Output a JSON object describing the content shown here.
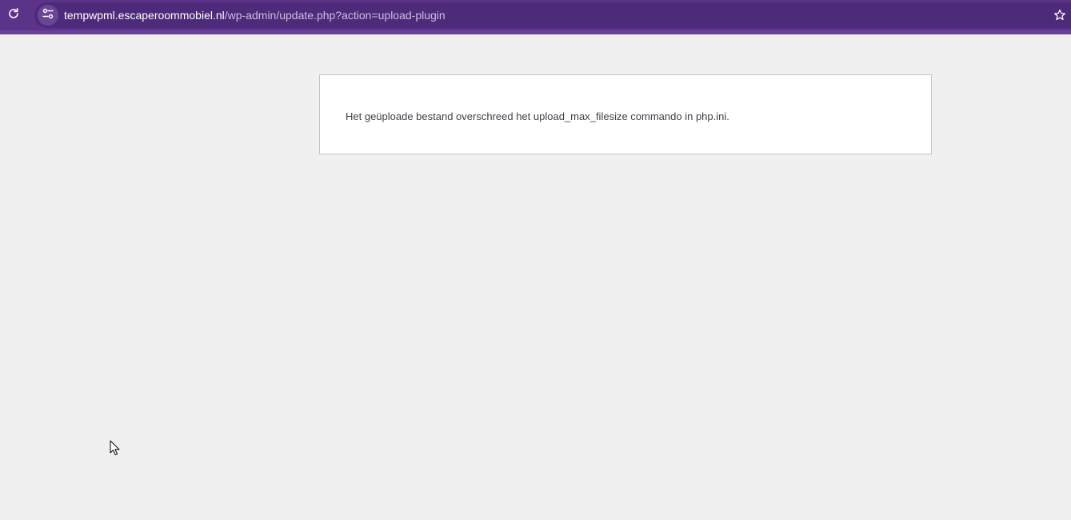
{
  "browser": {
    "url_host": "tempwpml.escaperoommobiel.nl",
    "url_path": "/wp-admin/update.php?action=upload-plugin",
    "icons": {
      "reload": "reload-icon",
      "site_info": "site-settings-icon",
      "bookmark": "star-icon"
    },
    "colors": {
      "toolbar": "#5b3489",
      "omnibox": "#4e2a7a"
    }
  },
  "page": {
    "error_message": "Het geüploade bestand overschreed het upload_max_filesize commando in php.ini."
  }
}
